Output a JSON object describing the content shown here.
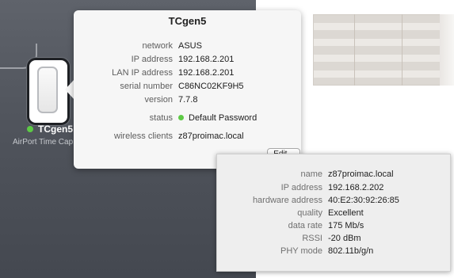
{
  "device": {
    "name": "TCgen5",
    "model": "AirPort Time Cap",
    "status_color": "#5dca45"
  },
  "popover": {
    "title": "TCgen5",
    "rows": [
      {
        "label": "network",
        "value": "ASUS"
      },
      {
        "label": "IP address",
        "value": "192.168.2.201"
      },
      {
        "label": "LAN IP address",
        "value": "192.168.2.201"
      },
      {
        "label": "serial number",
        "value": "C86NC02KF9H5"
      },
      {
        "label": "version",
        "value": "7.7.8"
      }
    ],
    "status": {
      "label": "status",
      "value": "Default Password",
      "indicator_color": "#5dca45"
    },
    "wireless": {
      "label": "wireless clients",
      "value": "z87proimac.local"
    },
    "edit_label": "Edit..."
  },
  "client": {
    "rows": [
      {
        "label": "name",
        "value": "z87proimac.local"
      },
      {
        "label": "IP address",
        "value": "192.168.2.202"
      },
      {
        "label": "hardware address",
        "value": "40:E2:30:92:26:85"
      },
      {
        "label": "quality",
        "value": "Excellent"
      },
      {
        "label": "data rate",
        "value": "175 Mb/s"
      },
      {
        "label": "RSSI",
        "value": "-20 dBm"
      },
      {
        "label": "PHY mode",
        "value": "802.11b/g/n"
      }
    ]
  }
}
